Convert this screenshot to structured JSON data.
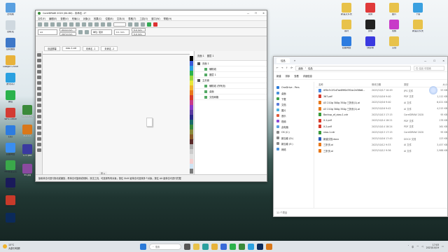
{
  "desktop": {
    "left_icons": [
      {
        "label": "此电脑",
        "color": "#5aa0e0"
      },
      {
        "label": "回收站",
        "color": "#cfd8df"
      },
      {
        "label": "控制面板",
        "color": "#3e78c8"
      },
      {
        "label": "Google Chrome",
        "color": "#e8b23a"
      },
      {
        "label": "腾讯QQ",
        "color": "#2aa0e0"
      },
      {
        "label": "微信",
        "color": "#2bb24c"
      },
      {
        "label": "WPS Office",
        "color": "#d33c34"
      },
      {
        "label": "钉钉",
        "color": "#2d7ce0"
      },
      {
        "label": "百度网盘",
        "color": "#3a8ef0"
      },
      {
        "label": "360安全卫士",
        "color": "#3aa84a"
      },
      {
        "label": "PR2025",
        "color": "#1a1a5a"
      },
      {
        "label": "FastStone",
        "color": "#c83a2a"
      },
      {
        "label": "PS2024",
        "color": "#0b2a5a"
      }
    ],
    "second_col_icons": [
      {
        "label": "Coreldraw",
        "color": "#3a8a3a"
      },
      {
        "label": "AI2024",
        "color": "#d9781a"
      },
      {
        "label": "123.psd",
        "color": "#3a3aa0"
      },
      {
        "label": "99.jpg",
        "color": "#8a4aa0"
      }
    ],
    "right_icons": [
      {
        "label": "新建文件夹",
        "color": "#e8c24a"
      },
      {
        "label": "素材",
        "color": "#e8c24a"
      },
      {
        "label": "百度网盘",
        "color": "#2d7ce0"
      },
      {
        "label": "录屏",
        "color": "#e03a3a"
      },
      {
        "label": "剪映",
        "color": "#222222"
      },
      {
        "label": "快剪辑",
        "color": "#3a3ae0"
      },
      {
        "label": "图片",
        "color": "#e8c24a"
      },
      {
        "label": "视频",
        "color": "#c83ac8"
      },
      {
        "label": "文档",
        "color": "#e8c24a"
      },
      {
        "label": "下载",
        "color": "#3aa0e0"
      },
      {
        "label": "新建文件夹",
        "color": "#e8c24a"
      }
    ]
  },
  "corel": {
    "title": "CorelDRAW 2020 (64-Bit) - 未命名 -1*",
    "menu": [
      "文件(F)",
      "编辑(E)",
      "查看(V)",
      "布局(L)",
      "对象(J)",
      "效果(C)",
      "位图(B)",
      "文本(X)",
      "表格(T)",
      "工具(O)",
      "窗口(W)",
      "帮助(H)"
    ],
    "page_size": "A4",
    "width": "210.0 mm",
    "height": "297.0 mm",
    "units": "单位: 毫米",
    "nudge": "0.1 mm",
    "dup_x": "5.0 mm",
    "dup_y": "5.0 mm",
    "doc_tabs": [
      "欢迎屏幕",
      "ciao-1.cdr",
      "未命名 -1",
      "未命名 -2"
    ],
    "page_tab": "页 1",
    "panel_header": [
      "页面 1",
      "图层 1"
    ],
    "panel_rows": [
      {
        "label": "页面 1",
        "level": 0
      },
      {
        "label": "辅助线",
        "level": 1
      },
      {
        "label": "图层 1",
        "level": 1
      },
      {
        "label": "主页面",
        "level": 0
      },
      {
        "label": "辅助线 (所有页)",
        "level": 1
      },
      {
        "label": "桌面",
        "level": 1
      },
      {
        "label": "文档网格",
        "level": 1
      }
    ],
    "status": "接着单击可进行拖动或缩放；再单击可旋转或倾斜；双击工具，可选择所有对象；按住 Shift 键单击可选择多个对象；按住 Alt 键单击可进行挖掘"
  },
  "explorer": {
    "tab": "佳品",
    "path": [
      "桌面",
      "佳品"
    ],
    "search_placeholder": "在 佳品 中搜索",
    "commands": [
      "新建",
      "排序",
      "查看",
      "详细信息"
    ],
    "nav": [
      {
        "label": "OneDrive - Pers",
        "color": "#2a7ad8"
      },
      {
        "label": "桌面",
        "color": "#4a90d8"
      },
      {
        "label": "下载",
        "color": "#3aa04a"
      },
      {
        "label": "文档",
        "color": "#5a7ad8"
      },
      {
        "label": "图片",
        "color": "#4ab0e0"
      },
      {
        "label": "音乐",
        "color": "#e05a3a"
      },
      {
        "label": "视频",
        "color": "#8a4ad8"
      },
      {
        "label": "此电脑",
        "color": "#5aa0e0"
      },
      {
        "label": "OS (C:)",
        "color": "#888888"
      },
      {
        "label": "新加卷 (D:)",
        "color": "#888888"
      },
      {
        "label": "新加卷 (E:)",
        "color": "#888888"
      },
      {
        "label": "网络",
        "color": "#4a90d8"
      }
    ],
    "columns": [
      "名称",
      "修改日期",
      "类型",
      "大小"
    ],
    "files": [
      {
        "name": "0f5b7c2f1d7ae89f0d3f1bc2e58b6...",
        "date": "2023/10/17 10:49",
        "type": "JPG 文件",
        "size": "53 KB",
        "color": "#4a8ae0"
      },
      {
        "name": "367.pdf",
        "date": "2023/10/16 9:40",
        "type": "PDF 文件",
        "size": "1,112 KB",
        "color": "#d83a2a"
      },
      {
        "name": "A3 210g 300g 350g 三折页(1).ai",
        "date": "2023/10/16 9:40",
        "type": "AI 文件",
        "size": "6,021 KB",
        "color": "#e8781a"
      },
      {
        "name": "A3 210g 300g 350g 三折页(1).ai",
        "date": "2023/10/16 9:42",
        "type": "AI 文件",
        "size": "4,215 KB",
        "color": "#e8781a"
      },
      {
        "name": "Backup_of_xiao-1.cdr",
        "date": "2023/10/13 17:15",
        "type": "CorelDRAW 2020",
        "size": "95 KB",
        "color": "#3a9a3a"
      },
      {
        "name": "X-1.pdf",
        "date": "2023/10/14 18:21",
        "type": "PDF 文件",
        "size": "178 KB",
        "color": "#d83a2a"
      },
      {
        "name": "X-2.pdf",
        "date": "2023/10/14 18:24",
        "type": "PDF 文件",
        "size": "161 KB",
        "color": "#d83a2a"
      },
      {
        "name": "xiao-1.cdr",
        "date": "2023/10/13 17:15",
        "type": "CorelDRAW 2020",
        "size": "95 KB",
        "color": "#3a9a3a"
      },
      {
        "name": "新建文档.docx",
        "date": "2023/10/16 17:45",
        "type": "DOCX 文档",
        "size": "123 KB",
        "color": "#2a5ab8"
      },
      {
        "name": "三折页.ai",
        "date": "2023/10/12 9:33",
        "type": "AI 文件",
        "size": "3,457 KB",
        "color": "#e8781a"
      },
      {
        "name": "三折页.ai",
        "date": "2023/10/12 9:36",
        "type": "AI 文件",
        "size": "2,988 KB",
        "color": "#e8781a"
      }
    ],
    "status": "11 个项目"
  },
  "taskbar": {
    "temp": "15°C",
    "weather": "大部分晴朗",
    "search": "搜索",
    "apps": [
      {
        "name": "windows-start",
        "color": "#2a7ad8"
      },
      {
        "name": "task-view",
        "color": "#555555"
      },
      {
        "name": "file-explorer",
        "color": "#e8c24a"
      },
      {
        "name": "edge",
        "color": "#2aa0a0"
      },
      {
        "name": "chrome",
        "color": "#e8b23a"
      },
      {
        "name": "store",
        "color": "#3a6ad8"
      },
      {
        "name": "wechat",
        "color": "#2bb24c"
      },
      {
        "name": "coreldraw",
        "color": "#3a8a3a"
      },
      {
        "name": "qq",
        "color": "#2aa0e0"
      },
      {
        "name": "photoshop",
        "color": "#0b2a5a"
      },
      {
        "name": "illustrator",
        "color": "#d9781a"
      }
    ],
    "time": "17:03",
    "date": "2023/10/19"
  }
}
